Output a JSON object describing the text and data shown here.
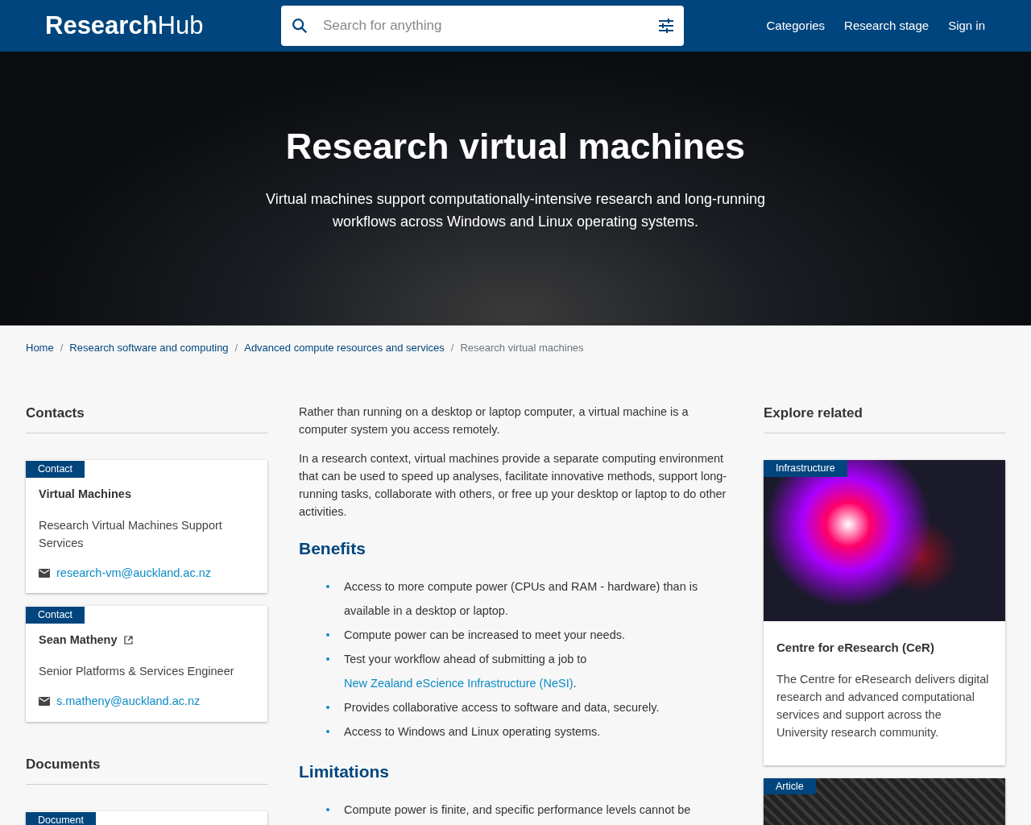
{
  "header": {
    "logo": "**Research**Hub",
    "search": {
      "placeholder": "Search for anything"
    },
    "nav": [
      "Categories",
      "Research stage",
      "Sign in"
    ]
  },
  "hero": {
    "title": "Research virtual machines",
    "subtitle": "Virtual machines support computationally-intensive research and long-running workflows across Windows and Linux operating systems."
  },
  "breadcrumb": [
    {
      "label": "Home",
      "current": false
    },
    {
      "separator": "/",
      "label": "Research software and computing",
      "current": false
    },
    {
      "separator": "/",
      "label": "Advanced compute resources and services",
      "current": false
    },
    {
      "separator": "/",
      "label": "Research virtual machines",
      "current": true
    }
  ],
  "contacts": {
    "heading": "Contacts",
    "cards": [
      {
        "tag": "Contact",
        "name": "Virtual Machines",
        "external": false,
        "role": "Research Virtual Machines Support Services",
        "email": "research-vm@auckland.ac.nz"
      },
      {
        "tag": "Contact",
        "name": "Sean Matheny",
        "external": true,
        "role": "Senior Platforms & Services Engineer",
        "email": "s.matheny@auckland.ac.nz"
      }
    ]
  },
  "documents": {
    "heading": "Documents",
    "cards": [
      {
        "tag": "Document"
      }
    ]
  },
  "body": {
    "paragraphs": [
      "Rather than running on a desktop or laptop computer, a virtual machine is a computer system you access remotely.",
      "In a research context, virtual machines provide a separate computing environment that can be used to speed up analyses, facilitate innovative methods, support long-running tasks, collaborate with others, or free up your desktop or laptop to do other activities."
    ],
    "sections": [
      {
        "heading": "Benefits",
        "items": [
          {
            "text": "Access to more compute power (CPUs and RAM - hardware) than is available in a desktop or laptop."
          },
          {
            "text": "Compute power can be increased to meet your needs."
          },
          {
            "text": "Test your workflow ahead of submitting a job to",
            "link": "New Zealand eScience Infrastructure (NeSI)",
            "after": "."
          },
          {
            "text": "Provides collaborative access to software and data, securely."
          },
          {
            "text": "Access to Windows and Linux operating systems."
          }
        ]
      },
      {
        "heading": "Limitations",
        "items": [
          {
            "text": "Compute power is finite, and specific performance levels cannot be"
          }
        ]
      }
    ]
  },
  "related": {
    "heading": "Explore related",
    "cards": [
      {
        "tag": "Infrastructure",
        "title": "Centre for eResearch (CeR)",
        "text": "The Centre for eResearch delivers digital research and advanced computational services and support across the University research community."
      },
      {
        "tag": "Article"
      }
    ]
  }
}
